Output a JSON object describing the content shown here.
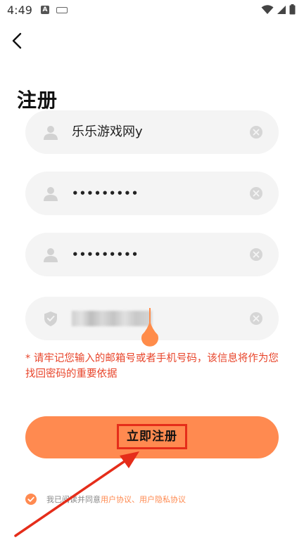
{
  "status_bar": {
    "time": "4:49",
    "input_badge": "A"
  },
  "header": {
    "back_icon": "back-arrow-icon",
    "title": "注册"
  },
  "form": {
    "username_value": "乐乐游戏网y",
    "password_value": "•••••••••",
    "confirm_password_value": "•••••••••",
    "icons": {
      "user": "user-icon",
      "shield": "shield-icon",
      "clear": "clear-icon"
    }
  },
  "hint": "* 请牢记您输入的邮箱号或者手机号码，该信息将作为您找回密码的重要依据",
  "submit_label": "立即注册",
  "agreement": {
    "prefix": "我已阅读并同意",
    "user_agreement": "用户协议",
    "separator": "、",
    "privacy_agreement": "用户隐私协议"
  },
  "colors": {
    "accent": "#ff8a50",
    "hint": "#e8452b",
    "annotation": "#e52d1a",
    "field_bg": "#f4f4f4"
  }
}
